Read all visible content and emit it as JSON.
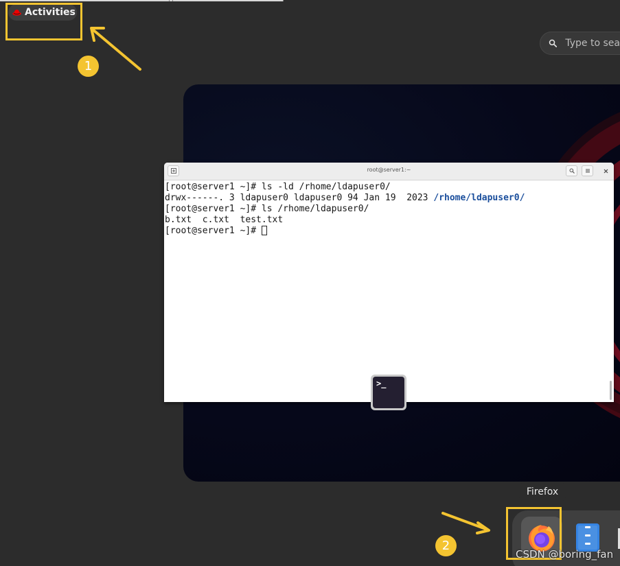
{
  "top_bar": {
    "activities_label": "Activities"
  },
  "search": {
    "placeholder": "Type to search"
  },
  "terminal": {
    "title": "root@server1:~",
    "lines": [
      {
        "text": "[root@server1 ~]# ls -ld /rhome/ldapuser0/"
      },
      {
        "text": "drwx------. 3 ldapuser0 ldapuser0 94 Jan 19  2023 ",
        "highlight": "/rhome/ldapuser0/"
      },
      {
        "text": "[root@server1 ~]# ls /rhome/ldapuser0/"
      },
      {
        "text": "b.txt  c.txt  test.txt"
      },
      {
        "text": "[root@server1 ~]# "
      }
    ]
  },
  "terminal_icon": {
    "glyph": ">_"
  },
  "tooltip": {
    "label": "Firefox"
  },
  "annotations": {
    "step1": "1",
    "step2": "2"
  },
  "dash": {
    "items": [
      "firefox-icon",
      "files-icon"
    ]
  },
  "watermark": "CSDN @boring_fan",
  "colors": {
    "callout": "#f4c431",
    "desktop_bg": "#2c2c2c",
    "directory_text": "#1a4e9c"
  }
}
